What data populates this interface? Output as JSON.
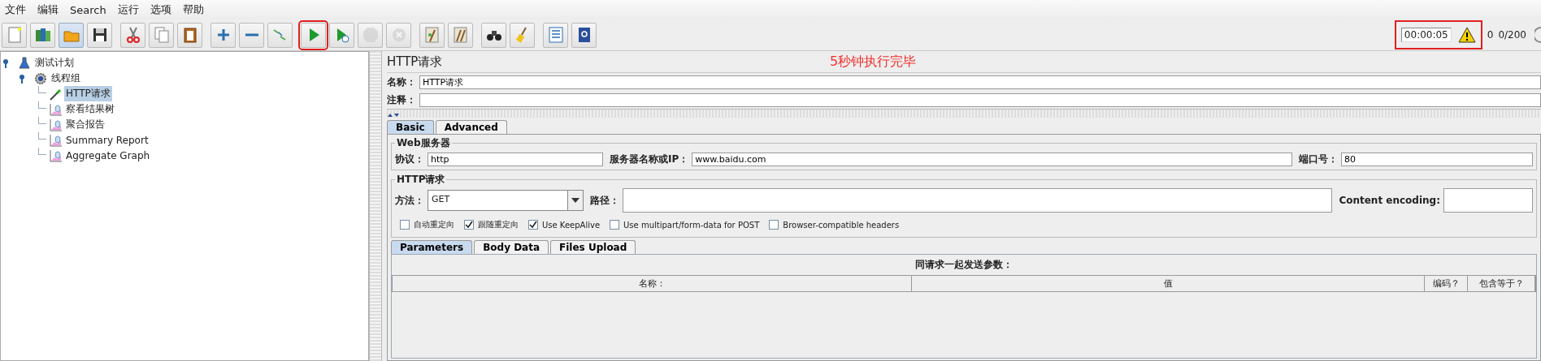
{
  "menu": [
    "文件",
    "编辑",
    "Search",
    "运行",
    "选项",
    "帮助"
  ],
  "toolbar": [
    [
      {
        "kind": "new",
        "disabled": false,
        "pressed": false,
        "highlighted": false
      },
      {
        "kind": "templates",
        "disabled": false,
        "pressed": false,
        "highlighted": false
      },
      {
        "kind": "open",
        "disabled": false,
        "pressed": true,
        "highlighted": false
      },
      {
        "kind": "save",
        "disabled": false,
        "pressed": false,
        "highlighted": false
      }
    ],
    [
      {
        "kind": "cut",
        "disabled": false,
        "pressed": false,
        "highlighted": false
      },
      {
        "kind": "copy",
        "disabled": false,
        "pressed": false,
        "highlighted": false
      },
      {
        "kind": "paste",
        "disabled": false,
        "pressed": false,
        "highlighted": false
      }
    ],
    [
      {
        "kind": "expand",
        "disabled": false,
        "pressed": false,
        "highlighted": false
      },
      {
        "kind": "collapse",
        "disabled": false,
        "pressed": false,
        "highlighted": false
      },
      {
        "kind": "toggle",
        "disabled": false,
        "pressed": false,
        "highlighted": false
      }
    ],
    [
      {
        "kind": "start",
        "disabled": false,
        "pressed": false,
        "highlighted": true
      },
      {
        "kind": "start_no_pause",
        "disabled": false,
        "pressed": false,
        "highlighted": false
      },
      {
        "kind": "stop",
        "disabled": true,
        "pressed": false,
        "highlighted": false
      },
      {
        "kind": "shutdown",
        "disabled": true,
        "pressed": false,
        "highlighted": false
      }
    ],
    [
      {
        "kind": "clear",
        "disabled": false,
        "pressed": false,
        "highlighted": false
      },
      {
        "kind": "clear_all",
        "disabled": false,
        "pressed": false,
        "highlighted": false
      }
    ],
    [
      {
        "kind": "search",
        "disabled": false,
        "pressed": false,
        "highlighted": false
      },
      {
        "kind": "reset",
        "disabled": false,
        "pressed": false,
        "highlighted": false
      }
    ],
    [
      {
        "kind": "function",
        "disabled": false,
        "pressed": false,
        "highlighted": false
      },
      {
        "kind": "help",
        "disabled": false,
        "pressed": false,
        "highlighted": false
      }
    ]
  ],
  "status": {
    "timer": "00:00:05",
    "highlighted": true,
    "warnings": "0",
    "threads": "0/200"
  },
  "tree": [
    {
      "label": "测试计划",
      "kind": "plan",
      "expanded": true,
      "selected": false,
      "children": [
        {
          "label": "线程组",
          "kind": "threads",
          "expanded": true,
          "selected": false,
          "children": [
            {
              "label": "HTTP请求",
              "kind": "sampler",
              "selected": true
            },
            {
              "label": "察看结果树",
              "kind": "listener",
              "selected": false
            },
            {
              "label": "聚合报告",
              "kind": "listener",
              "selected": false
            },
            {
              "label": "Summary Report",
              "kind": "listener",
              "selected": false
            },
            {
              "label": "Aggregate Graph",
              "kind": "listener",
              "selected": false
            }
          ]
        }
      ]
    }
  ],
  "panel": {
    "title": "HTTP请求",
    "annotation": "5秒钟执行完毕",
    "name": {
      "label": "名称：",
      "value": "HTTP请求"
    },
    "comment": {
      "label": "注释："
    },
    "tabs": [
      {
        "label": "Basic",
        "selected": true
      },
      {
        "label": "Advanced",
        "selected": false
      }
    ],
    "web_server": {
      "title": "Web服务器",
      "protocol": {
        "label": "协议：",
        "value": "http"
      },
      "server": {
        "label": "服务器名称或IP：",
        "value": "www.baidu.com"
      },
      "port": {
        "label": "端口号：",
        "value": "80"
      }
    },
    "http_request": {
      "title": "HTTP请求",
      "method": {
        "label": "方法：",
        "value": "GET"
      },
      "path": {
        "label": "路径："
      },
      "encoding": {
        "label": "Content encoding:"
      },
      "options": [
        {
          "label": "自动重定向",
          "checked": false
        },
        {
          "label": "跟随重定向",
          "checked": true
        },
        {
          "label": "Use KeepAlive",
          "checked": true
        },
        {
          "label": "Use multipart/form-data for POST",
          "checked": false
        },
        {
          "label": "Browser-compatible headers",
          "checked": false
        }
      ]
    },
    "sub_tabs": [
      {
        "label": "Parameters",
        "selected": true
      },
      {
        "label": "Body Data",
        "selected": false
      },
      {
        "label": "Files Upload",
        "selected": false
      }
    ],
    "params": {
      "caption": "同请求一起发送参数：",
      "columns": [
        "名称：",
        "值",
        "编码？",
        "包含等于？"
      ]
    }
  }
}
